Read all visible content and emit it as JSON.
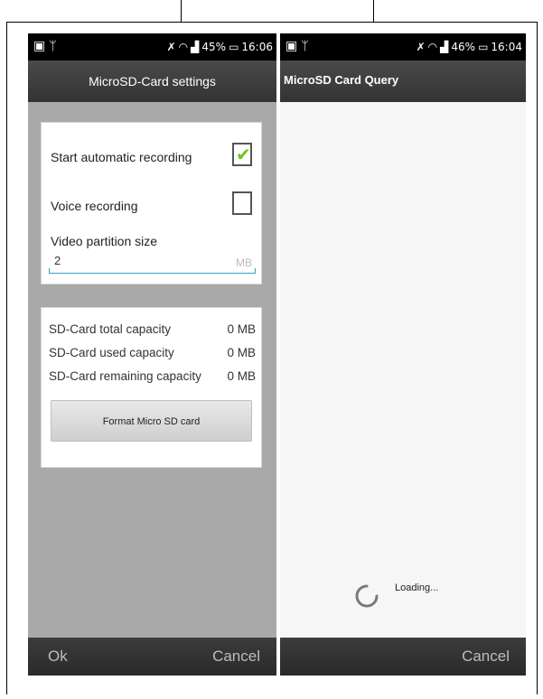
{
  "left_screen": {
    "statusbar": {
      "left_icons": [
        "image-icon",
        "usb-icon"
      ],
      "battery": "45%",
      "time": "16:06"
    },
    "title": "MicroSD-Card settings",
    "settings": {
      "auto_recording_label": "Start automatic recording",
      "auto_recording_checked": true,
      "voice_recording_label": "Voice recording",
      "voice_recording_checked": false,
      "partition_label": "Video partition size",
      "partition_value": "2",
      "partition_unit": "MB"
    },
    "capacity": [
      {
        "label": "SD-Card total capacity",
        "value": "0 MB"
      },
      {
        "label": "SD-Card used capacity",
        "value": "0 MB"
      },
      {
        "label": "SD-Card remaining capacity",
        "value": "0 MB"
      }
    ],
    "format_button": "Format Micro SD card",
    "ok_label": "Ok",
    "cancel_label": "Cancel"
  },
  "right_screen": {
    "statusbar": {
      "left_icons": [
        "image-icon",
        "usb-icon"
      ],
      "battery": "46%",
      "time": "16:04"
    },
    "title": "MicroSD Card Query",
    "loading_text": "Loading...",
    "cancel_label": "Cancel"
  },
  "colors": {
    "checkmark": "#6ec31c",
    "input_underline": "#3aa0c8",
    "background_gray": "#a9a9a9"
  }
}
